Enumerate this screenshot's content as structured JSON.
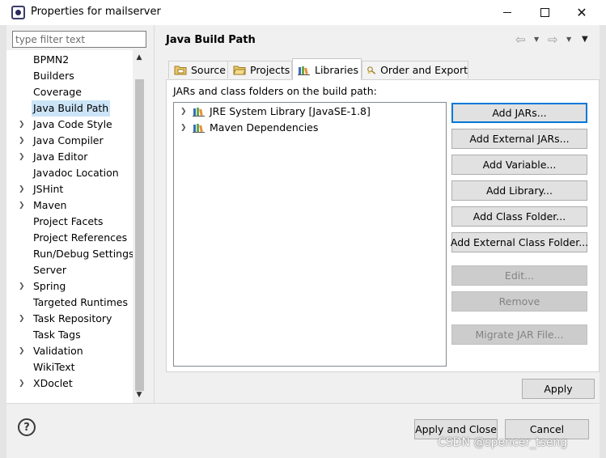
{
  "window": {
    "title": "Properties for mailserver",
    "close_glyph": "✕"
  },
  "filter": {
    "placeholder": "type filter text"
  },
  "nav": {
    "items": [
      {
        "label": "BPMN2",
        "expandable": false
      },
      {
        "label": "Builders",
        "expandable": false
      },
      {
        "label": "Coverage",
        "expandable": false
      },
      {
        "label": "Java Build Path",
        "expandable": false,
        "selected": true
      },
      {
        "label": "Java Code Style",
        "expandable": true
      },
      {
        "label": "Java Compiler",
        "expandable": true
      },
      {
        "label": "Java Editor",
        "expandable": true
      },
      {
        "label": "Javadoc Location",
        "expandable": false
      },
      {
        "label": "JSHint",
        "expandable": true
      },
      {
        "label": "Maven",
        "expandable": true
      },
      {
        "label": "Project Facets",
        "expandable": false
      },
      {
        "label": "Project References",
        "expandable": false
      },
      {
        "label": "Run/Debug Settings",
        "expandable": false
      },
      {
        "label": "Server",
        "expandable": false
      },
      {
        "label": "Spring",
        "expandable": true
      },
      {
        "label": "Targeted Runtimes",
        "expandable": false
      },
      {
        "label": "Task Repository",
        "expandable": true
      },
      {
        "label": "Task Tags",
        "expandable": false
      },
      {
        "label": "Validation",
        "expandable": true
      },
      {
        "label": "WikiText",
        "expandable": false
      },
      {
        "label": "XDoclet",
        "expandable": true
      }
    ]
  },
  "page": {
    "title": "Java Build Path"
  },
  "tabs": [
    {
      "label": "Source",
      "icon": "source-folder-icon"
    },
    {
      "label": "Projects",
      "icon": "projects-folder-icon"
    },
    {
      "label": "Libraries",
      "icon": "libraries-icon",
      "active": true
    },
    {
      "label": "Order and Export",
      "icon": "order-export-icon"
    }
  ],
  "libraries": {
    "label": "JARs and class folders on the build path:",
    "items": [
      {
        "label": "JRE System Library [JavaSE-1.8]"
      },
      {
        "label": "Maven Dependencies"
      }
    ],
    "buttons": {
      "add_jars": "Add JARs...",
      "add_external_jars": "Add External JARs...",
      "add_variable": "Add Variable...",
      "add_library": "Add Library...",
      "add_class_folder": "Add Class Folder...",
      "add_external_class_folder": "Add External Class Folder...",
      "edit": "Edit...",
      "remove": "Remove",
      "migrate_jar": "Migrate JAR File..."
    }
  },
  "footer": {
    "apply": "Apply",
    "apply_and_close": "Apply and Close",
    "cancel": "Cancel",
    "help": "?"
  },
  "watermark": "CSDN @spencer_tseng",
  "colors": {
    "selection": "#cce4f7",
    "focus_border": "#0078d7",
    "button_bg": "#e1e1e1"
  }
}
